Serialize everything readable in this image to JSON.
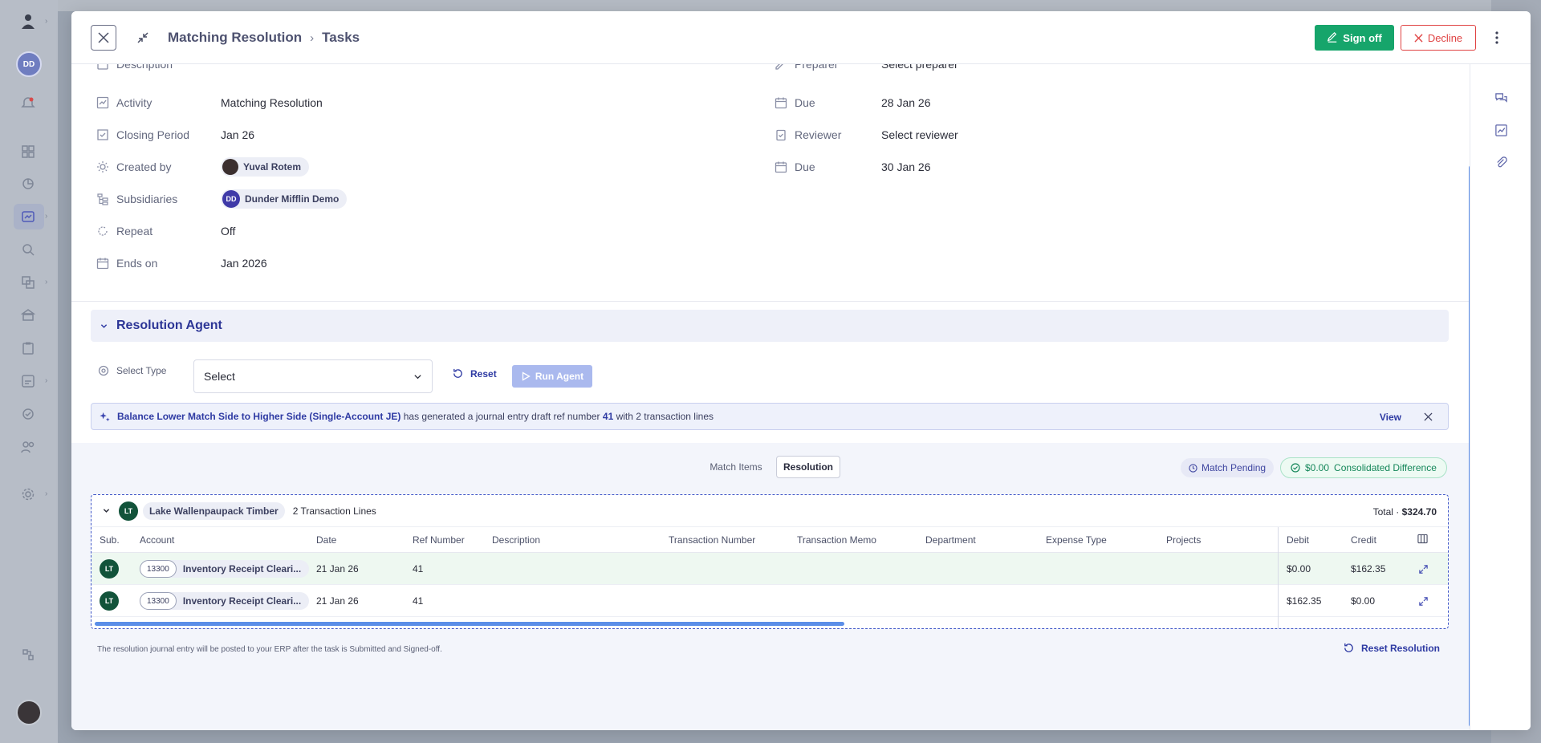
{
  "breadcrumb": {
    "parent": "Matching Resolution",
    "current": "Tasks"
  },
  "header": {
    "signoff_label": "Sign off",
    "decline_label": "Decline"
  },
  "org_initials": "DD",
  "details": {
    "description_label": "Description",
    "preparer_label": "Preparer",
    "preparer_value": "Select preparer",
    "activity_label": "Activity",
    "activity_value": "Matching Resolution",
    "due1_label": "Due",
    "due1_value": "28 Jan 26",
    "closing_label": "Closing Period",
    "closing_value": "Jan 26",
    "reviewer_label": "Reviewer",
    "reviewer_value": "Select reviewer",
    "created_label": "Created by",
    "created_value": "Yuval Rotem",
    "due2_label": "Due",
    "due2_value": "30 Jan 26",
    "subsidiaries_label": "Subsidiaries",
    "subsidiaries_initials": "DD",
    "subsidiaries_value": "Dunder Mifflin Demo",
    "repeat_label": "Repeat",
    "repeat_value": "Off",
    "ends_label": "Ends on",
    "ends_value": "Jan 2026"
  },
  "agent": {
    "title": "Resolution Agent",
    "select_type_label": "Select Type",
    "select_value": "Select",
    "reset_label": "Reset",
    "run_label": "Run Agent",
    "banner": {
      "strategy": "Balance Lower Match Side to Higher Side (Single-Account JE)",
      "text1": "has generated a journal entry draft ref number",
      "ref": "41",
      "text2": "with 2 transaction lines",
      "view_label": "View"
    }
  },
  "match": {
    "tab_match_items": "Match Items",
    "tab_resolution": "Resolution",
    "pending_label": "Match Pending",
    "diff_amount": "$0.00",
    "diff_label": "Consolidated Difference",
    "group": {
      "initials": "LT",
      "vendor": "Lake Wallenpaupack Timber",
      "lines": "2 Transaction Lines",
      "total_label": "Total ·",
      "total_value": "$324.70"
    },
    "columns": {
      "sub": "Sub.",
      "account": "Account",
      "date": "Date",
      "ref": "Ref Number",
      "description": "Description",
      "tx_number": "Transaction Number",
      "tx_memo": "Transaction Memo",
      "department": "Department",
      "expense": "Expense Type",
      "projects": "Projects",
      "debit": "Debit",
      "credit": "Credit"
    },
    "rows": [
      {
        "sub": "LT",
        "account_num": "13300",
        "account": "Inventory Receipt Cleari...",
        "date": "21 Jan 26",
        "ref": "41",
        "debit": "$0.00",
        "credit": "$162.35"
      },
      {
        "sub": "LT",
        "account_num": "13300",
        "account": "Inventory Receipt Cleari...",
        "date": "21 Jan 26",
        "ref": "41",
        "debit": "$162.35",
        "credit": "$0.00"
      }
    ],
    "note": "The resolution journal entry will be posted to your ERP after the task is Submitted and Signed-off.",
    "reset_resolution_label": "Reset Resolution"
  }
}
